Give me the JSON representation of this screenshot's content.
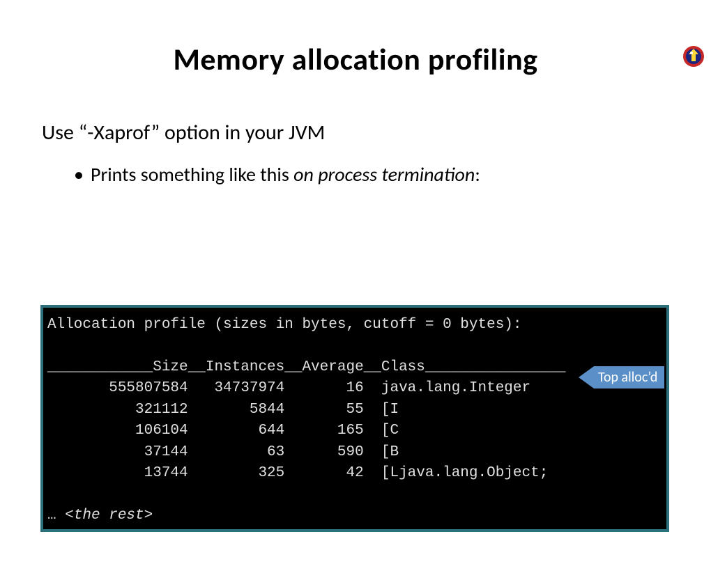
{
  "title": "Memory allocation profiling",
  "line1": "Use “-Xaprof” option in your JVM",
  "bullet_prefix": "Prints something like this ",
  "bullet_italic": "on process termination",
  "bullet_suffix": ":",
  "terminal": {
    "header": "Allocation profile (sizes in bytes, cutoff = 0 bytes):",
    "columns_line": "____________Size__Instances__Average__Class________________",
    "rows": [
      {
        "size": "555807584",
        "instances": "34737974",
        "average": "16",
        "class": "java.lang.Integer"
      },
      {
        "size": "321112",
        "instances": "5844",
        "average": "55",
        "class": "[I"
      },
      {
        "size": "106104",
        "instances": "644",
        "average": "165",
        "class": "[C"
      },
      {
        "size": "37144",
        "instances": "63",
        "average": "590",
        "class": "[B"
      },
      {
        "size": "13744",
        "instances": "325",
        "average": "42",
        "class": "[Ljava.lang.Object;"
      }
    ],
    "rest_prefix": "… ",
    "rest_italic": "<the rest>"
  },
  "callout": "Top alloc’d"
}
